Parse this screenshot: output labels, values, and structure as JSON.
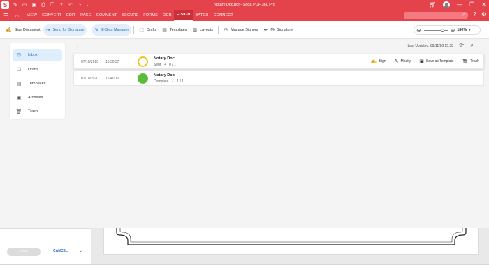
{
  "window": {
    "title": "Notary Doc.pdf  -  Soda PDF 360 Pro",
    "logo_letter": "S"
  },
  "menu": {
    "items": [
      "VIEW",
      "CONVERT",
      "EDIT",
      "PAGE",
      "COMMENT",
      "SECURE",
      "FORMS",
      "OCR",
      "E-SIGN",
      "BATCH",
      "CONNECT"
    ],
    "active": "E-SIGN"
  },
  "toolbar": {
    "sign_document": "Sign Document",
    "send_for_signature": "Send for Signature",
    "esign_manager": "E-Sign Manager",
    "drafts": "Drafts",
    "templates": "Templates",
    "layouts": "Layouts",
    "manage_signers": "Manage Signers",
    "my_signature": "My Signature",
    "zoom": "180%"
  },
  "sidebar": {
    "items": [
      {
        "label": "Inbox",
        "icon": "inbox-icon"
      },
      {
        "label": "Drafts",
        "icon": "drafts-icon"
      },
      {
        "label": "Templates",
        "icon": "templates-icon"
      },
      {
        "label": "Archives",
        "icon": "archive-icon"
      },
      {
        "label": "Trash",
        "icon": "trash-icon"
      }
    ],
    "selected": "Inbox"
  },
  "list": {
    "last_updated": "Last Updated: 09/11/20 15:38",
    "rows": [
      {
        "date": "07/10/2020",
        "time": "15:30:37",
        "status": "sent",
        "status_color": "#f2c31f",
        "name": "Notary Doc",
        "state": "Sent",
        "signed": "0",
        "total": "1"
      },
      {
        "date": "07/10/2020",
        "time": "15:40:12",
        "status": "complete",
        "status_color": "#5cbb3b",
        "name": "Notary Doc",
        "state": "Complete",
        "signed": "1",
        "total": "1"
      }
    ],
    "actions": {
      "sign": "Sign",
      "modify": "Modify",
      "save_as_template": "Save as Template",
      "trash": "Trash"
    }
  },
  "bottom": {
    "save_label": "SAVE",
    "cancel_label": "CANCEL"
  },
  "colors": {
    "brand": "#e5434b",
    "accent": "#2b6fc3"
  }
}
